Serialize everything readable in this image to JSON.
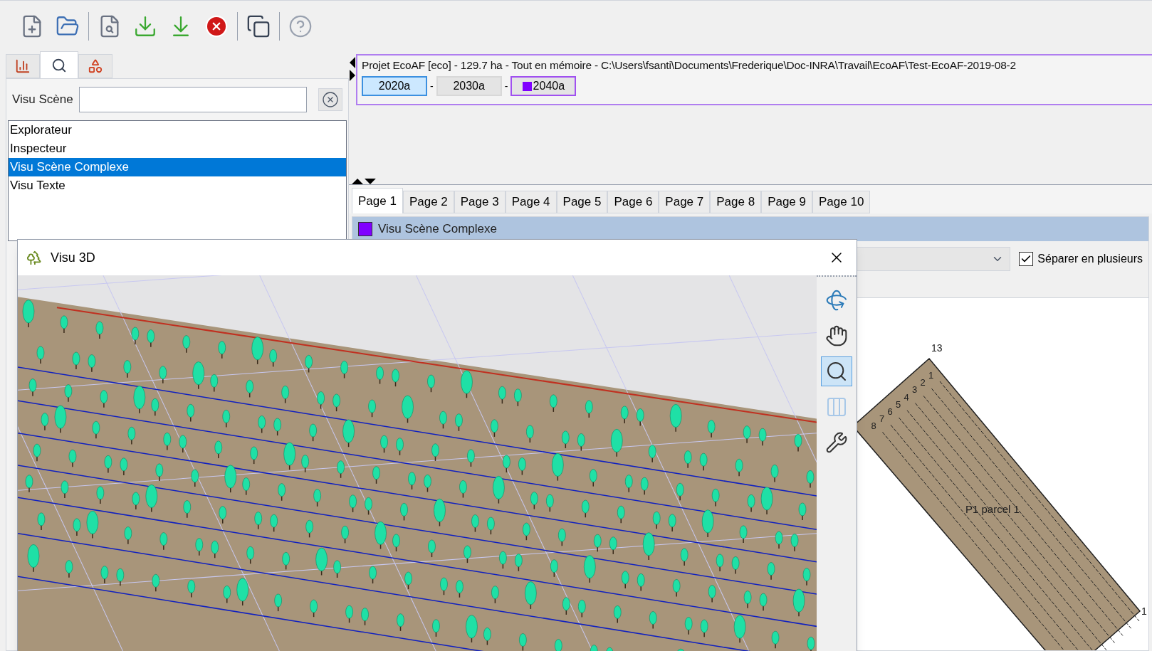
{
  "left_panel": {
    "tabs": [
      {
        "kind": "chart",
        "selected": false
      },
      {
        "kind": "search",
        "selected": true
      },
      {
        "kind": "shapes",
        "selected": false
      }
    ],
    "search_label": "Visu Scène",
    "items": [
      {
        "label": "Explorateur",
        "selected": false
      },
      {
        "label": "Inspecteur",
        "selected": false
      },
      {
        "label": "Visu Scène Complexe",
        "selected": true
      },
      {
        "label": "Visu Texte",
        "selected": false
      }
    ]
  },
  "project": {
    "title": "Projet EcoAF [eco] - 129.7 ha - Tout en mémoire - C:\\Users\\fsanti\\Documents\\Frederique\\Doc-INRA\\Travail\\EcoAF\\Test-EcoAF-2019-08-2",
    "steps": [
      {
        "label": "2020a",
        "selected": true,
        "marked": false
      },
      {
        "label": "2030a",
        "selected": false,
        "marked": false
      },
      {
        "label": "2040a",
        "selected": false,
        "marked": true,
        "color": "#8000ff"
      }
    ],
    "separators": [
      "-",
      "-"
    ]
  },
  "page_tabs": [
    {
      "label": "Page 1",
      "selected": true
    },
    {
      "label": "Page 2",
      "selected": false
    },
    {
      "label": "Page 3",
      "selected": false
    },
    {
      "label": "Page 4",
      "selected": false
    },
    {
      "label": "Page 5",
      "selected": false
    },
    {
      "label": "Page 6",
      "selected": false
    },
    {
      "label": "Page 7",
      "selected": false
    },
    {
      "label": "Page 8",
      "selected": false
    },
    {
      "label": "Page 9",
      "selected": false
    },
    {
      "label": "Page 10",
      "selected": false
    }
  ],
  "panel": {
    "title": "Visu Scène Complexe",
    "color": "#8000ff",
    "checkbox": {
      "label": "Séparer en plusieurs",
      "checked": true
    }
  },
  "parcel_map": {
    "corner_labels": [
      "13",
      "1"
    ],
    "row_labels": [
      "1",
      "2",
      "3",
      "4",
      "5",
      "6",
      "7",
      "8"
    ],
    "parcel_label": "P1 parcel 1"
  },
  "window": {
    "title": "Visu 3D",
    "tools": [
      {
        "kind": "rotate",
        "selected": false
      },
      {
        "kind": "pan",
        "selected": false
      },
      {
        "kind": "zoom",
        "selected": true
      },
      {
        "kind": "bars",
        "selected": false
      },
      {
        "kind": "tools",
        "selected": false
      }
    ]
  }
}
